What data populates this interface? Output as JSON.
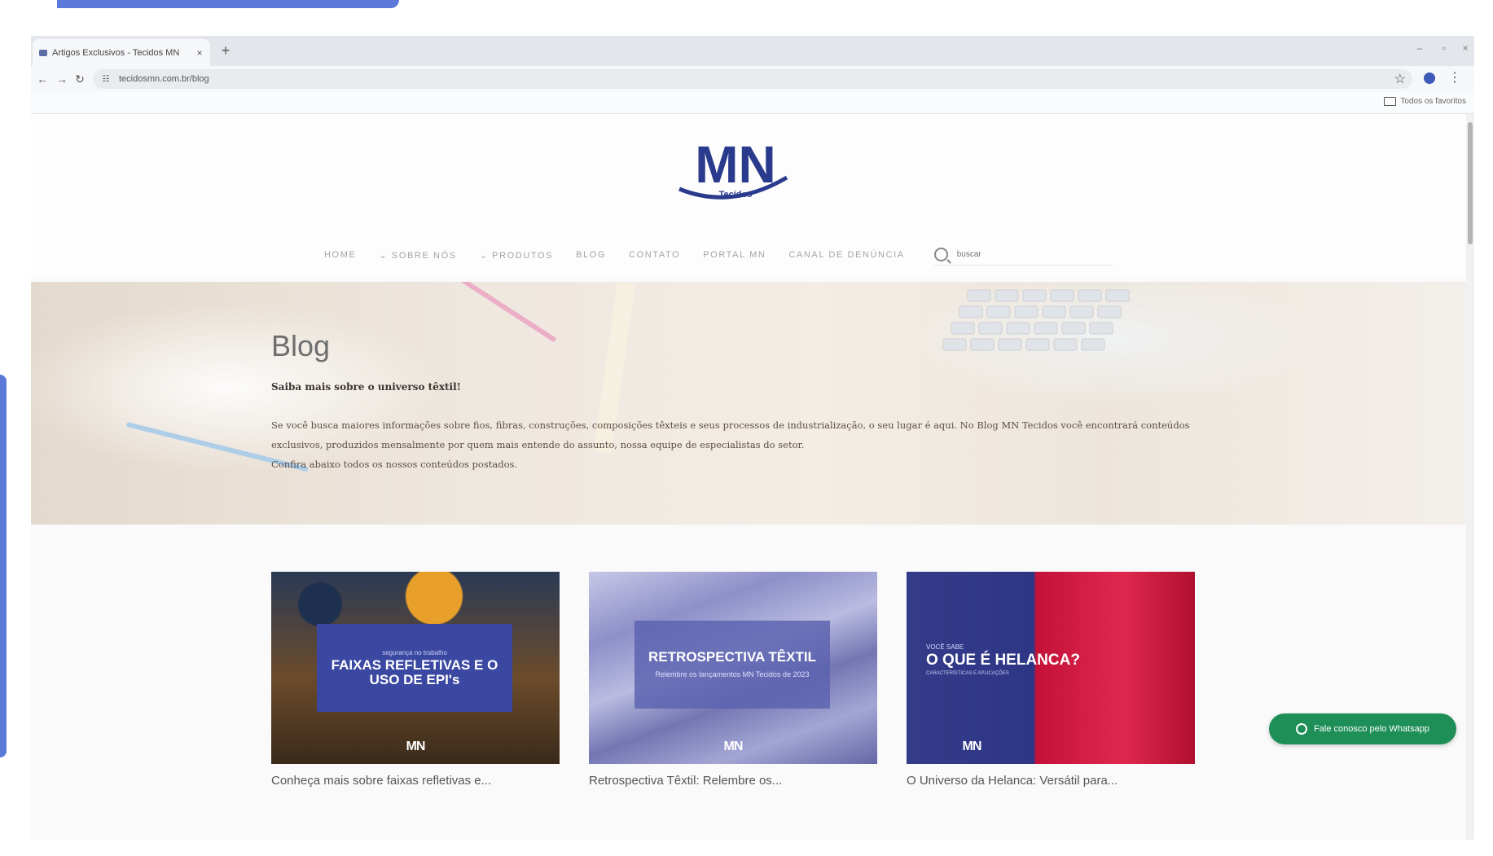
{
  "browser": {
    "tab_title": "Artigos Exclusivos - Tecidos MN",
    "new_tab_symbol": "+",
    "close_symbol": "×",
    "url": "tecidosmn.com.br/blog",
    "bookmarks_label": "Todos os favoritos",
    "window_controls": {
      "minimize": "–",
      "maximize": "▫",
      "close": "×"
    },
    "nav": {
      "back": "←",
      "forward": "→",
      "reload": "↻"
    },
    "star_symbol": "☆",
    "menu_symbol": "⋮",
    "site_info_symbol": "☷"
  },
  "site": {
    "logo_text": "MN",
    "logo_sub": "Tecidos",
    "nav": {
      "home": "HOME",
      "sobre": "⌄ SOBRE NÓS",
      "produtos": "⌄ PRODUTOS",
      "blog": "BLOG",
      "contato": "CONTATO",
      "portal": "PORTAL MN",
      "canal": "CANAL DE DENÚNCIA"
    },
    "search_placeholder": "buscar"
  },
  "hero": {
    "title": "Blog",
    "subtitle": "Saiba mais sobre o universo têxtil!",
    "paragraph1": "Se você busca maiores informações sobre fios, fibras, construções, composições têxteis e seus processos de industrialização, o seu lugar é aqui. No Blog MN Tecidos você encontrará conteúdos exclusivos, produzidos mensalmente por quem mais entende do assunto, nossa equipe de especialistas do setor.",
    "paragraph2": "Confira abaixo todos os nossos conteúdos postados."
  },
  "cards": [
    {
      "small": "segurança no trabalho",
      "big": "FAIXAS REFLETIVAS E O USO DE EPI's",
      "logo": "MN",
      "title": "Conheça mais sobre faixas refletivas e..."
    },
    {
      "big": "RETROSPECTIVA TÊXTIL",
      "sub": "Relembre os lançamentos MN Tecidos de 2023",
      "logo": "MN",
      "title": "Retrospectiva Têxtil: Relembre os..."
    },
    {
      "small": "VOCÊ SABE",
      "big": "O QUE É HELANCA?",
      "tiny": "CARACTERÍSTICAS E APLICAÇÕES",
      "logo": "MN",
      "title": "O Universo da Helanca: Versátil para..."
    }
  ],
  "whatsapp": {
    "label": "Fale conosco pelo Whatsapp"
  },
  "colors": {
    "brand_blue": "#2a3a8c",
    "accent_deco": "#5b79d8",
    "whatsapp_green": "#1f8f58"
  }
}
